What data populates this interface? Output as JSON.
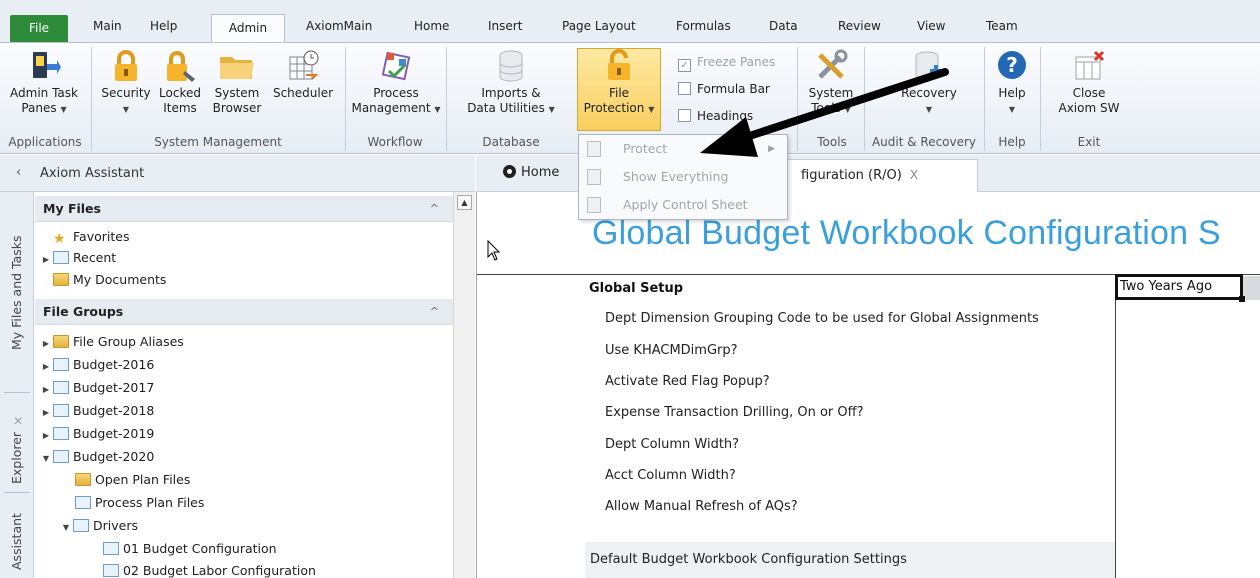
{
  "ribbon_tabs": {
    "file": "File",
    "main": "Main",
    "help": "Help",
    "admin": "Admin",
    "axiommain": "AxiomMain",
    "home": "Home",
    "insert": "Insert",
    "page_layout": "Page Layout",
    "formulas": "Formulas",
    "data": "Data",
    "review": "Review",
    "view": "View",
    "team": "Team"
  },
  "ribbon": {
    "admin_task_panes": [
      "Admin Task",
      "Panes"
    ],
    "security": "Security",
    "locked_items": [
      "Locked",
      "Items"
    ],
    "system_browser": [
      "System",
      "Browser"
    ],
    "scheduler": "Scheduler",
    "process_management": [
      "Process",
      "Management"
    ],
    "imports_utilities": [
      "Imports &",
      "Data Utilities"
    ],
    "file_protection": [
      "File",
      "Protection"
    ],
    "freeze_panes": "Freeze Panes",
    "formula_bar": "Formula Bar",
    "headings": "Headings",
    "system_tools": [
      "System",
      "Tools"
    ],
    "recovery": "Recovery",
    "help": "Help",
    "close_axiom": [
      "Close",
      "Axiom SW"
    ],
    "groups": {
      "applications": "Applications",
      "system_management": "System Management",
      "workflow": "Workflow",
      "database": "Database",
      "tools": "Tools",
      "audit_recovery": "Audit & Recovery",
      "help": "Help",
      "exit": "Exit"
    }
  },
  "menu": {
    "protect": "Protect",
    "show_everything": "Show Everything",
    "apply_control_sheet": "Apply Control Sheet"
  },
  "left_pane": {
    "title": "Axiom Assistant",
    "vertical_tabs": [
      "My Files and Tasks",
      "Explorer",
      "Assistant"
    ],
    "my_files": {
      "header": "My Files",
      "items": [
        "Favorites",
        "Recent",
        "My Documents"
      ]
    },
    "file_groups": {
      "header": "File Groups",
      "items": [
        "File Group Aliases",
        "Budget-2016",
        "Budget-2017",
        "Budget-2018",
        "Budget-2019",
        "Budget-2020"
      ],
      "budget2020_children": [
        "Open Plan Files",
        "Process Plan Files",
        "Drivers"
      ],
      "drivers_children": [
        "01 Budget Configuration",
        "02 Budget Labor Configuration"
      ]
    }
  },
  "doc_tabs": {
    "home": "Home",
    "config": "figuration (R/O)",
    "close_glyph": "X"
  },
  "sheet": {
    "title": "Global Budget Workbook Configuration S",
    "section": "Global Setup",
    "selected_cell": "Two Years Ago",
    "rows": [
      "Dept Dimension Grouping Code to be used for Global Assignments",
      "Use KHACMDimGrp?",
      "Activate Red Flag Popup?",
      "Expense Transaction Drilling, On or Off?",
      "Dept Column Width?",
      "Acct Column Width?",
      "Allow Manual Refresh of AQs?"
    ],
    "footer_band": "Default Budget Workbook Configuration Settings"
  }
}
